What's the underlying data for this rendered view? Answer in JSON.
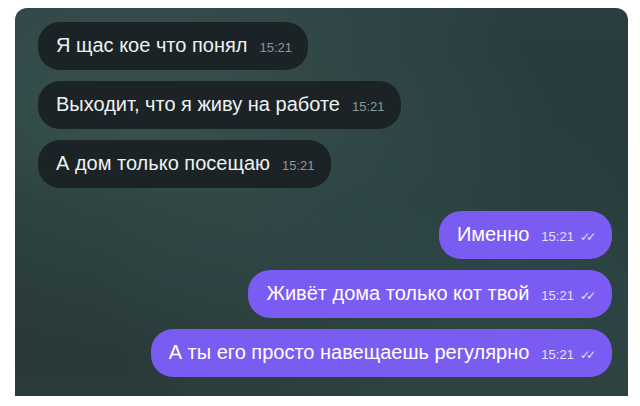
{
  "chat": {
    "messages": [
      {
        "kind": "incoming",
        "text": "Я щас кое что понял",
        "time": "15:21"
      },
      {
        "kind": "incoming",
        "text": "Выходит, что я живу на работе",
        "time": "15:21"
      },
      {
        "kind": "incoming",
        "text": "А дом только посещаю",
        "time": "15:21"
      },
      {
        "kind": "outgoing",
        "text": "Именно",
        "time": "15:21",
        "ticks": "✓✓"
      },
      {
        "kind": "outgoing",
        "text": "Живёт дома только кот твой",
        "time": "15:21",
        "ticks": "✓✓"
      },
      {
        "kind": "outgoing",
        "text": "А ты его просто навещаешь регулярно",
        "time": "15:21",
        "ticks": "✓✓"
      }
    ]
  }
}
